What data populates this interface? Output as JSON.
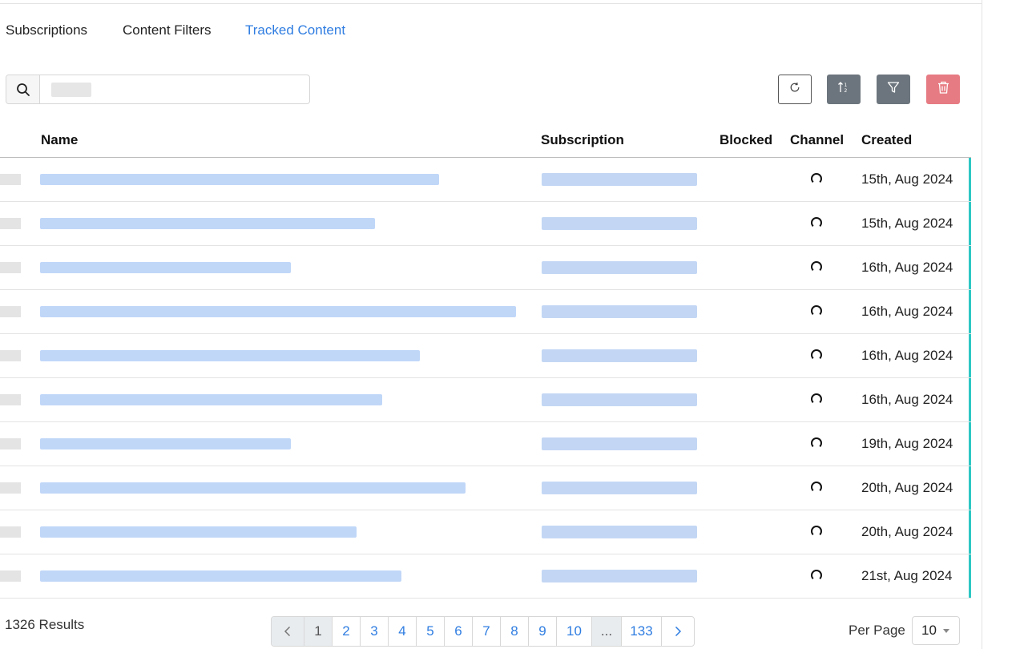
{
  "tabs": [
    {
      "label": "Subscriptions",
      "active": false
    },
    {
      "label": "Content Filters",
      "active": false
    },
    {
      "label": "Tracked Content",
      "active": true
    }
  ],
  "search": {
    "placeholder": "",
    "value": ""
  },
  "toolbar": {
    "refresh_icon": "refresh-icon",
    "sort_icon": "sort-numeric-icon",
    "filter_icon": "filter-icon",
    "delete_icon": "trash-icon"
  },
  "table": {
    "columns": [
      "Name",
      "Subscription",
      "Blocked",
      "Channel",
      "Created"
    ],
    "rows": [
      {
        "created": "15th, Aug 2024"
      },
      {
        "created": "15th, Aug 2024"
      },
      {
        "created": "16th, Aug 2024"
      },
      {
        "created": "16th, Aug 2024"
      },
      {
        "created": "16th, Aug 2024"
      },
      {
        "created": "16th, Aug 2024"
      },
      {
        "created": "19th, Aug 2024"
      },
      {
        "created": "20th, Aug 2024"
      },
      {
        "created": "20th, Aug 2024"
      },
      {
        "created": "21st, Aug 2024"
      }
    ]
  },
  "results_text": "1326 Results",
  "pagination": {
    "prev_icon": "chevron-left-icon",
    "next_icon": "chevron-right-icon",
    "pages": [
      "1",
      "2",
      "3",
      "4",
      "5",
      "6",
      "7",
      "8",
      "9",
      "10",
      "...",
      "133"
    ],
    "current": "1"
  },
  "per_page": {
    "label": "Per Page",
    "value": "10"
  },
  "colors": {
    "accent": "#2f7de1",
    "row_marker": "#2ec7c4",
    "danger": "#e77b83",
    "secondary": "#6c757d"
  }
}
